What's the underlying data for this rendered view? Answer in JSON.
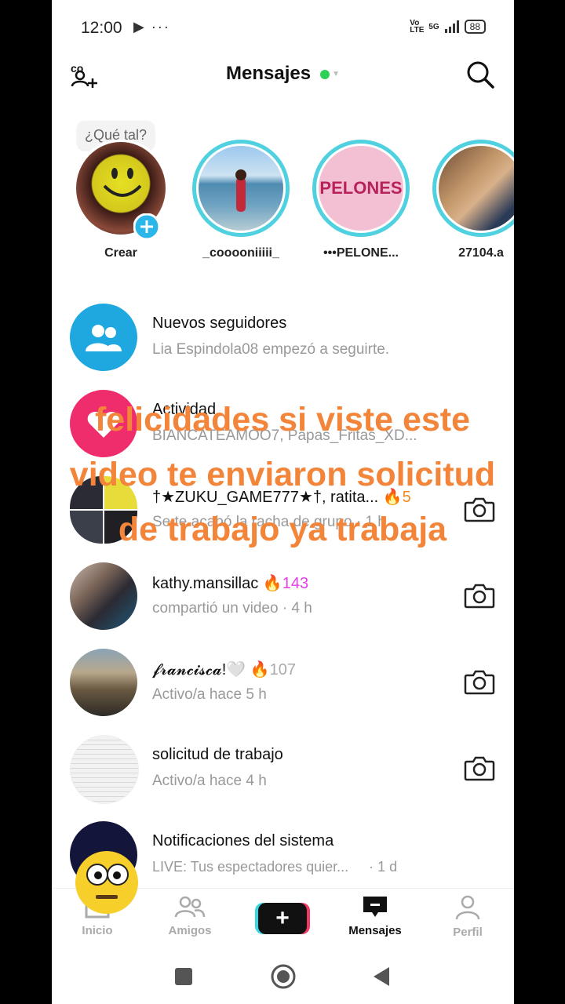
{
  "status": {
    "time": "12:00",
    "left_icons": "▶ ···",
    "network_1": "Vo LTE",
    "network_2": "5G",
    "battery": "88"
  },
  "header": {
    "title": "Mensajes"
  },
  "stories": {
    "bubble": "¿Qué tal?",
    "items": [
      {
        "name": "Crear"
      },
      {
        "name": "_cooooniiiii_"
      },
      {
        "name": "•••PELONE..."
      },
      {
        "name": "27104.a"
      }
    ],
    "pelones_logo": "PELONES"
  },
  "list": {
    "rows": [
      {
        "title": "Nuevos seguidores",
        "subtitle": "Lia Espindola08 empezó a seguirte."
      },
      {
        "title": "Actividad",
        "subtitle": "BIANCATEAMOO7, Papas_Fritas_XD..."
      },
      {
        "title": "†★ZUKU_GAME777★†, ratita...",
        "streak": "5",
        "subtitle": "Se te acabó la racha de grupo · 1 h"
      },
      {
        "title": "kathy.mansillac",
        "streak": "143",
        "subtitle": "compartió un video · 4 h"
      },
      {
        "title": "𝓯𝓻𝓪𝓷𝓬𝓲𝓼𝓬𝓪!🤍",
        "streak": "107",
        "subtitle": "Activo/a hace 5 h"
      },
      {
        "title": "solicitud de trabajo",
        "subtitle": "Activo/a hace 4 h"
      },
      {
        "title": "Notificaciones del sistema",
        "subtitle": "LIVE: Tus espectadores quier...",
        "time": "· 1 d"
      }
    ]
  },
  "overlay": {
    "line1": "felicidades si viste este",
    "line2": "video te enviaron solicitud",
    "line3": "de trabajo ya trabaja"
  },
  "tabs": [
    {
      "label": "Inicio"
    },
    {
      "label": "Amigos"
    },
    {
      "label": "Mensajes"
    },
    {
      "label": "Perfil"
    }
  ],
  "colors": {
    "accent_cyan": "#4fd1e0",
    "accent_pink": "#f03a64",
    "overlay_text": "#f3853a",
    "streak_pink": "#e63ee6",
    "online": "#2ed158"
  }
}
